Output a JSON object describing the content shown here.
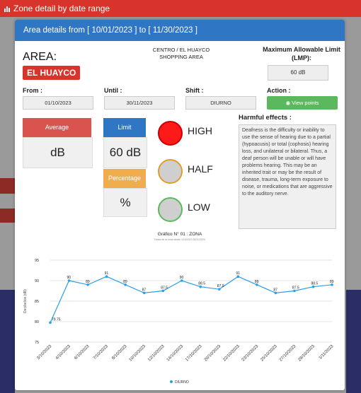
{
  "topbar": {
    "title": "Zone detail by date range"
  },
  "modal": {
    "header": "Area details from [ 10/01/2023 ] to [ 11/30/2023 ]",
    "area_label": "AREA:",
    "area_name": "EL HUAYCO",
    "location_line1": "CENTRO / EL HUAYCO",
    "location_line2": "SHOPPING AREA",
    "lmp_title": "Maximum Allowable Limit (LMP):",
    "lmp_value": "60 dB",
    "from_label": "From :",
    "from_value": "01/10/2023",
    "until_label": "Until :",
    "until_value": "30/11/2023",
    "shift_label": "Shift :",
    "shift_value": "DIURNO",
    "action_label": "Action :",
    "view_button": "View points",
    "average_label": "Average",
    "average_value": "dB",
    "limit_label": "Limit",
    "limit_value": "60 dB",
    "percentage_label": "Percentage",
    "percentage_value": "%",
    "levels": {
      "high": "HIGH",
      "half": "HALF",
      "low": "LOW"
    },
    "harmful_title": "Harmful effects :",
    "harmful_text": "Deafness is the difficulty or inability to use the sense of hearing due to a partial (hypoacusis) or total (cophosis) hearing loss, and unilateral or bilateral. Thus, a deaf person will be unable or will have problems hearing. This may be an inherited trait or may be the result of disease, trauma, long-term exposure to noise, or medications that are aggressive to the auditory nerve.",
    "chart_title": "Gráfico N° 01 : ZONA",
    "chart_subtitle": "Datos de la zona desde 1/10/2023 30/11/2023"
  },
  "colors": {
    "red": "#d9342b",
    "blue": "#2f77c4",
    "green": "#5cb85c",
    "orange": "#f0ad4e",
    "line": "#2b9fe8"
  },
  "icons": {
    "topbar": "bar-chart-icon",
    "view": "eye-icon"
  },
  "chart_data": {
    "type": "line",
    "x": [
      "3/10/2023",
      "4/10/2023",
      "6/10/2023",
      "7/10/2023",
      "8/10/2023",
      "10/10/2023",
      "12/10/2023",
      "14/10/2023",
      "17/10/2023",
      "20/10/2023",
      "22/10/2023",
      "23/10/2023",
      "25/10/2023",
      "27/10/2023",
      "29/10/2023",
      "1/11/2023"
    ],
    "series": [
      {
        "name": "DIURNO",
        "values": [
          79.75,
          90,
          89,
          91,
          89,
          87,
          87.5,
          90,
          88.5,
          87.9,
          91,
          89,
          87,
          87.5,
          88.5,
          89
        ]
      }
    ],
    "point_labels": [
      "79.75",
      "90",
      "89",
      "91",
      "89",
      "87",
      "87.5",
      "90",
      "88.5",
      "87.9",
      "91",
      "89",
      "87",
      "87.5",
      "88.5",
      "89"
    ],
    "ylabel": "Decibelios (dB)",
    "ylim": [
      75,
      95
    ],
    "yticks": [
      "75",
      "80",
      "85",
      "90",
      "95"
    ],
    "grid": true,
    "legend": "bottom"
  }
}
